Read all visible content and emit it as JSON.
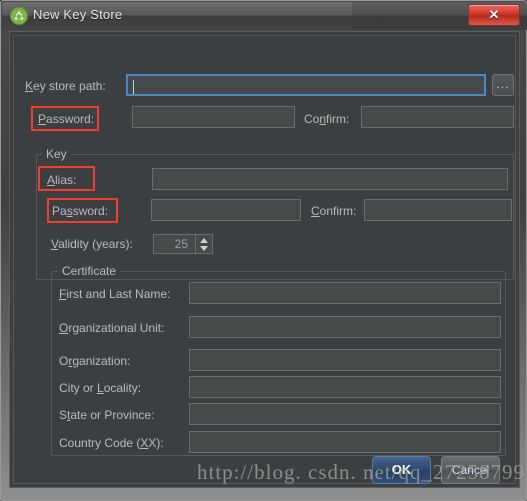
{
  "window": {
    "title": "New Key Store",
    "app_icon": "android-studio-icon",
    "close_label": "✕"
  },
  "keystore": {
    "path_label": "Key store path:",
    "path_label_mnemonic": "K",
    "path_value": "",
    "browse_label": "...",
    "password_label": "Password:",
    "password_label_mnemonic": "P",
    "password_value": "",
    "confirm_label": "Confirm:",
    "confirm_label_mnemonic": "n",
    "confirm_value": ""
  },
  "key_group": {
    "title": "Key",
    "alias_label": "Alias:",
    "alias_label_mnemonic": "A",
    "alias_value": "",
    "password_label": "Password:",
    "password_label_mnemonic": "s",
    "password_value": "",
    "confirm_label": "Confirm:",
    "confirm_label_mnemonic": "C",
    "confirm_value": "",
    "validity_label": "Validity (years):",
    "validity_label_mnemonic": "V",
    "validity_value": "25"
  },
  "certificate_group": {
    "title": "Certificate",
    "fields": [
      {
        "label_pre": "",
        "label_mn": "F",
        "label_post": "irst and Last Name:",
        "value": ""
      },
      {
        "label_pre": "",
        "label_mn": "O",
        "label_post": "rganizational Unit:",
        "value": ""
      },
      {
        "label_pre": "O",
        "label_mn": "r",
        "label_post": "ganization:",
        "value": ""
      },
      {
        "label_pre": "City or ",
        "label_mn": "L",
        "label_post": "ocality:",
        "value": ""
      },
      {
        "label_pre": "S",
        "label_mn": "t",
        "label_post": "ate or Province:",
        "value": ""
      },
      {
        "label_pre": "Country Code (",
        "label_mn": "X",
        "label_post": "X):",
        "value": ""
      }
    ]
  },
  "footer": {
    "ok_label": "OK",
    "cancel_label": "Cancel"
  },
  "watermark": {
    "text": "http://blog. csdn. net/qq_27258799"
  },
  "colors": {
    "background": "#3c3f41",
    "field": "#45494a",
    "focus_border": "#4a88c7",
    "annotation": "#ef3d2e",
    "default_button": "#2f4b72",
    "close_button": "#d33b2c"
  }
}
